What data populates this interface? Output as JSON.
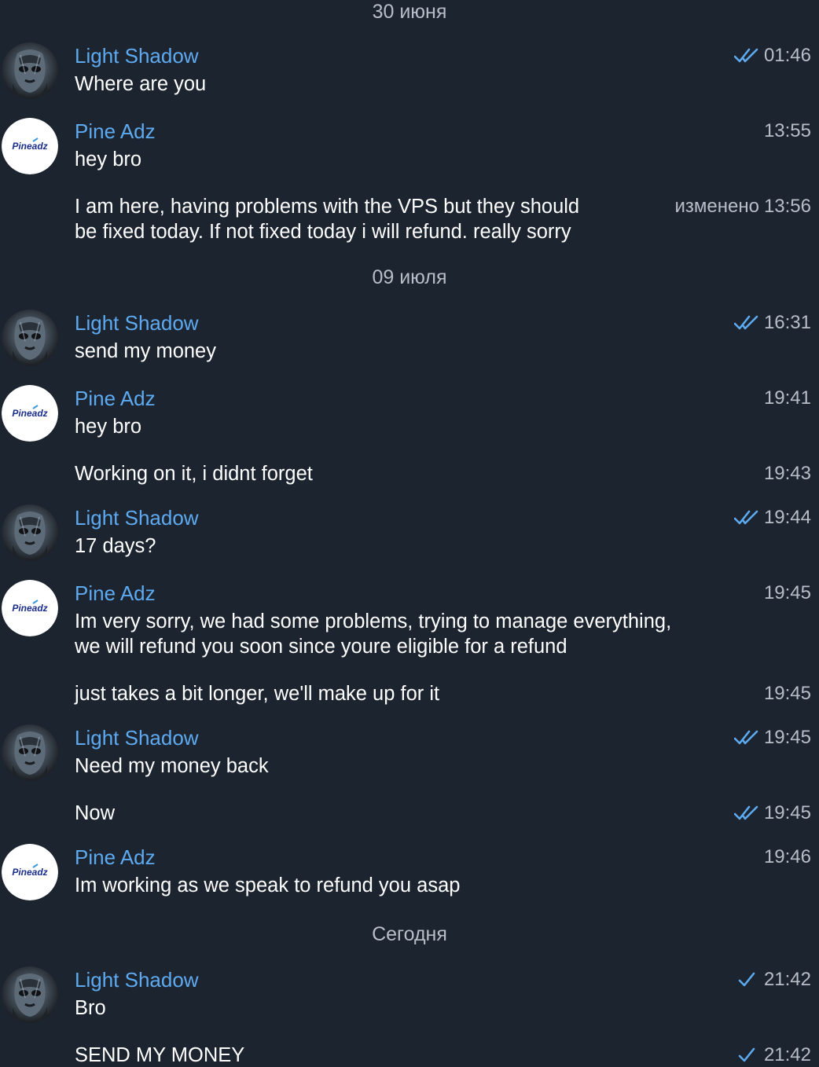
{
  "dates": [
    "30 июня",
    "09 июля",
    "Сегодня"
  ],
  "senders": {
    "light": "Light Shadow",
    "pine": "Pine Adz"
  },
  "pine_logo_text": "Pineadz",
  "edited_label": "изменено",
  "messages": [
    {
      "name": "Light Shadow",
      "text": "Where are you",
      "time": "01:46",
      "ticks": "double"
    },
    {
      "name": "Pine Adz",
      "text": "hey bro",
      "time": "13:55"
    },
    {
      "text1": "I am here, having problems with the VPS but they should",
      "text2": "be fixed today. If not fixed today i will refund. really sorry",
      "time": "13:56"
    },
    {
      "name": "Light Shadow",
      "text": "send my money",
      "time": "16:31",
      "ticks": "double"
    },
    {
      "name": "Pine Adz",
      "text": "hey bro",
      "time": "19:41"
    },
    {
      "text": "Working on it, i didnt forget",
      "time": "19:43"
    },
    {
      "name": "Light Shadow",
      "text": "17 days?",
      "time": "19:44",
      "ticks": "double"
    },
    {
      "name": "Pine Adz",
      "text1": "Im very sorry, we had some problems, trying to manage everything,",
      "text2": "we will refund you soon since youre eligible for a refund",
      "time": "19:45"
    },
    {
      "text": "just takes a bit longer, we'll make up for it",
      "time": "19:45"
    },
    {
      "name": "Light Shadow",
      "text": "Need my money back",
      "time": "19:45",
      "ticks": "double"
    },
    {
      "text": "Now",
      "time": "19:45",
      "ticks": "double"
    },
    {
      "name": "Pine Adz",
      "text": "Im working as we speak to refund you asap",
      "time": "19:46"
    },
    {
      "name": "Light Shadow",
      "text": "Bro",
      "time": "21:42",
      "ticks": "single"
    },
    {
      "text": "SEND MY MONEY",
      "time": "21:42",
      "ticks": "single"
    }
  ],
  "colors": {
    "background": "#1c2430",
    "name": "#5eaaf0",
    "meta": "#b8bec6",
    "check": "#5eaaf0"
  }
}
